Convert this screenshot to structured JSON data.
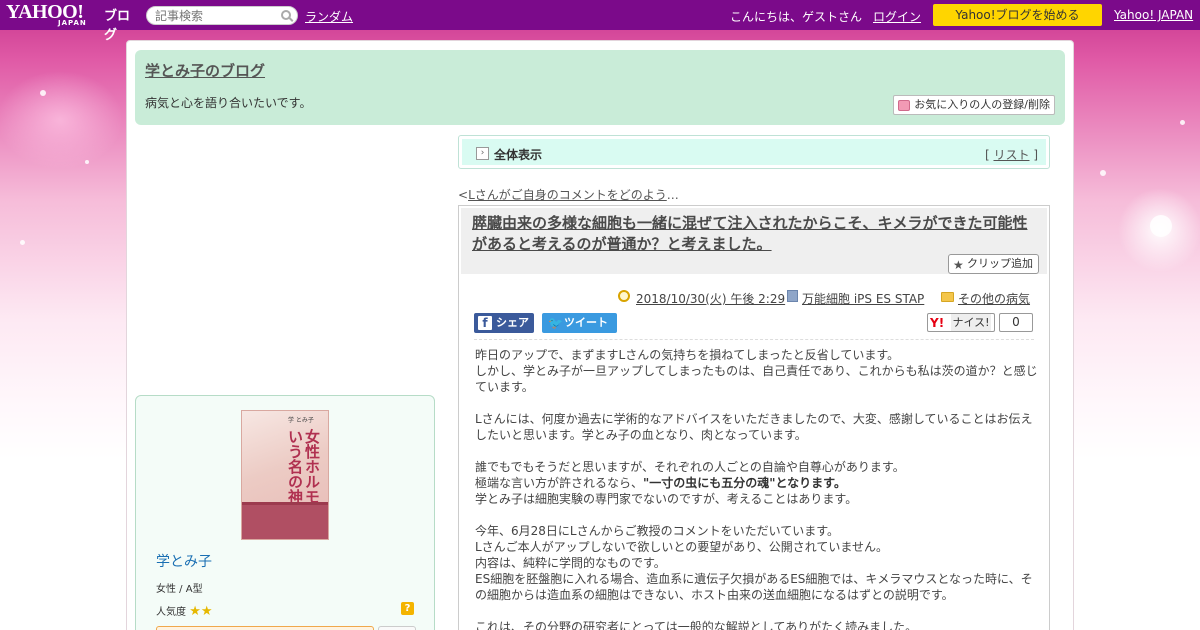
{
  "topbar": {
    "logo_main": "YAHOO!",
    "logo_sub": "JAPAN",
    "logo_blog": "ブログ",
    "search_placeholder": "記事検索",
    "random_link": "ランダム",
    "greeting": "こんにちは、ゲストさん",
    "login_link": "ログイン",
    "start_button": "Yahoo!ブログを始める",
    "yahoo_japan_link": "Yahoo! JAPAN"
  },
  "blog": {
    "title": "学とみ子のブログ",
    "description": "病気と心を語り合いたいです。",
    "favorite_button": "お気に入りの人の登録/削除"
  },
  "profile": {
    "book_title": "女性ホルモンという名の神話",
    "book_author": "学 とみ子",
    "name": "学とみ子",
    "info": "女性 / A型",
    "popularity_label": "人気度",
    "popularity_stars": 2,
    "help_icon": "?"
  },
  "nav": {
    "view_all": "全体表示",
    "list_open": "[ ",
    "list_link": "リスト",
    "list_close": " ]",
    "prev_prefix": "<",
    "prev_link": "Lさんがご自身のコメントをどのよう",
    "prev_suffix": "…"
  },
  "article": {
    "title": "膵臓由来の多様な細胞も一緒に混ぜて注入されたからこそ、キメラができた可能性があると考えるのが普通か？と考えました。",
    "clip_button": "クリップ追加",
    "date": "2018/10/30(火) 午後 2:29",
    "category": "万能細胞 iPS ES STAP",
    "folder": "その他の病気",
    "share_label": "シェア",
    "tweet_label": "ツイート",
    "nice_label": "ナイス!",
    "nice_count": "0",
    "paragraphs": [
      "昨日のアップで、まずますLさんの気持ちを損ねてしまったと反省しています。",
      "しかし、学とみ子が一旦アップしてしまったものは、自己責任であり、これからも私は茨の道か？と感じています。",
      "",
      "Lさんには、何度か過去に学術的なアドバイスをいただきましたので、大変、感謝していることはお伝えしたいと思います。学とみ子の血となり、肉となっています。",
      "",
      "誰でもでもそうだと思いますが、それぞれの人ごとの自論や自尊心があります。",
      "極端な言い方が許されるなら、",
      "学とみ子は細胞実験の専門家でないのですが、考えることはあります。",
      "",
      "今年、6月28日にLさんからご教授のコメントをいただいています。",
      "Lさんご本人がアップしないで欲しいとの要望があり、公開されていません。",
      "内容は、純粋に学問的なものです。",
      "ES細胞を胚盤胞に入れる場合、造血系に遺伝子欠損があるES細胞では、キメラマウスとなった時に、その細胞からは造血系の細胞はできない、ホスト由来の送血細胞になるはずとの説明です。",
      "",
      "これは、その分野の研究者にとっては一般的な解説としてありがたく読みました。"
    ],
    "emphasis": "\"一寸の虫にも五分の魂\"となります。"
  }
}
